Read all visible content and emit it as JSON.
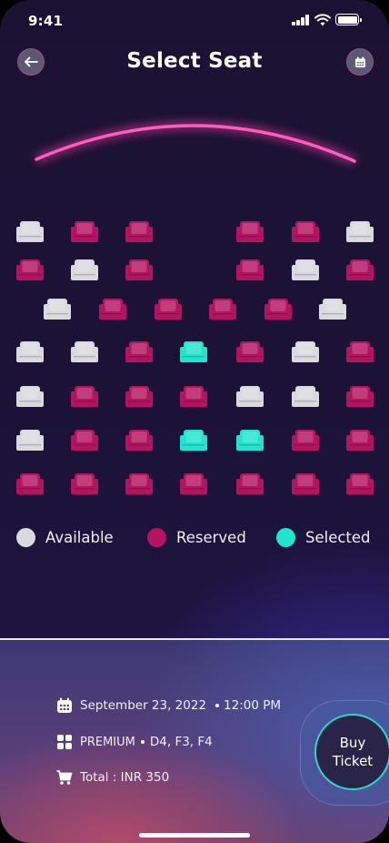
{
  "status_bar": {
    "time": "9:41"
  },
  "header": {
    "title": "Select Seat",
    "back_icon": "arrow-left-icon",
    "calendar_icon": "calendar-icon"
  },
  "colors": {
    "available": "#d9d9de",
    "reserved": "#b3145f",
    "selected": "#22e3cf",
    "screen": "#ff3fb0"
  },
  "seat_map": {
    "rows": [
      [
        "available",
        "reserved",
        "reserved",
        null,
        "reserved",
        "reserved",
        "available"
      ],
      [
        "reserved",
        "available",
        "reserved",
        null,
        "reserved",
        "available",
        "reserved"
      ],
      [
        "available",
        "reserved",
        "reserved",
        "reserved",
        "reserved",
        "available"
      ],
      [
        "available",
        "available",
        "reserved",
        "selected",
        "reserved",
        "available",
        "reserved"
      ],
      [
        "available",
        "reserved",
        "reserved",
        "reserved",
        "available",
        "available",
        "reserved"
      ],
      [
        "available",
        "reserved",
        "reserved",
        "selected",
        "selected",
        "reserved",
        "reserved"
      ],
      [
        "reserved",
        "reserved",
        "reserved",
        "reserved",
        "reserved",
        "reserved",
        "reserved"
      ]
    ]
  },
  "legend": [
    {
      "label": "Available",
      "status": "available"
    },
    {
      "label": "Reserved",
      "status": "reserved"
    },
    {
      "label": "Selected",
      "status": "selected"
    }
  ],
  "booking": {
    "date": "September 23, 2022",
    "time": "12:00 PM",
    "class": "PREMIUM",
    "seats": "D4, F3, F4",
    "total": "Total : INR 350",
    "buy_line1": "Buy",
    "buy_line2": "Ticket"
  }
}
